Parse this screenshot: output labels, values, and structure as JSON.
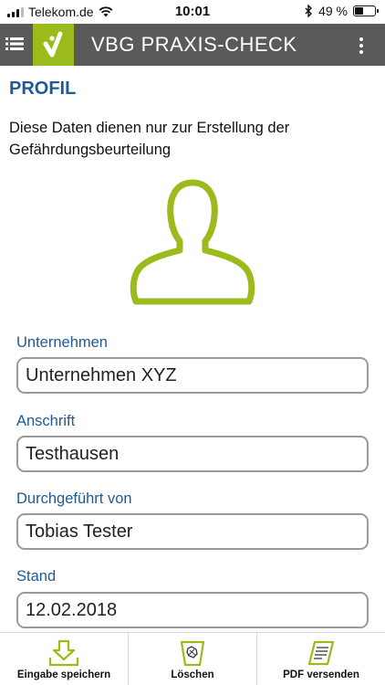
{
  "status_bar": {
    "carrier": "Telekom.de",
    "time": "10:01",
    "battery_text": "49 %",
    "battery_level": 0.49
  },
  "app_bar": {
    "title": "VBG PRAXIS-CHECK",
    "brand_color": "#9bbb1d",
    "bar_color": "#5a5a5a"
  },
  "page": {
    "title": "PROFIL",
    "intro": "Diese Daten dienen nur zur Erstellung der Gefährdungsbeurteilung",
    "accent_color": "#1f5a96"
  },
  "form": {
    "company_label": "Unternehmen",
    "company_value": "Unternehmen XYZ",
    "address_label": "Anschrift",
    "address_value": "Testhausen",
    "performed_by_label": "Durchgeführt von",
    "performed_by_value": "Tobias Tester",
    "date_label": "Stand",
    "date_value": "12.02.2018"
  },
  "toolbar": {
    "save_label": "Eingabe speichern",
    "delete_label": "Löschen",
    "pdf_label": "PDF versenden"
  },
  "icons": [
    "list-menu-icon",
    "vbg-logo-icon",
    "more-vertical-icon",
    "wifi-icon",
    "bluetooth-icon",
    "battery-icon",
    "user-silhouette-icon",
    "download-save-icon",
    "trash-bin-icon",
    "pdf-document-icon"
  ]
}
